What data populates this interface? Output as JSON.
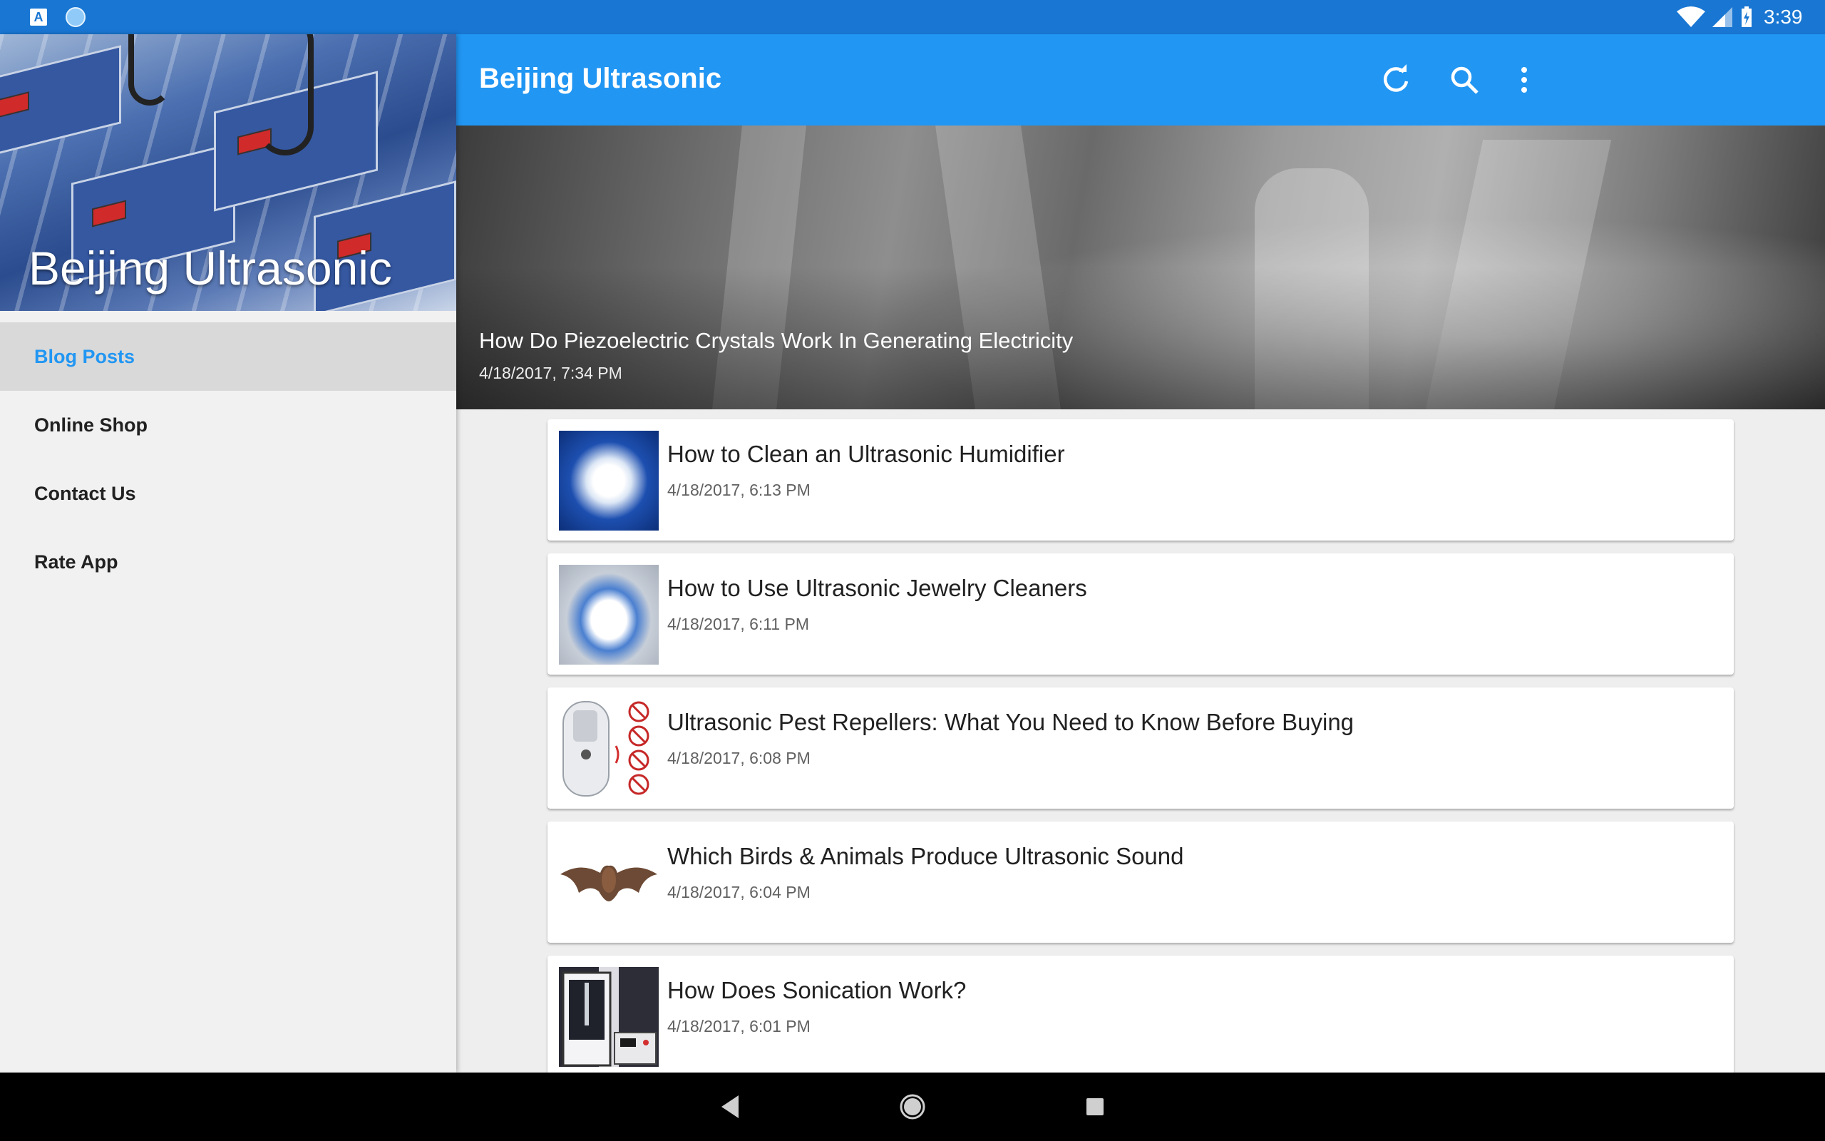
{
  "status_bar": {
    "time": "3:39",
    "notification_icon": "A"
  },
  "drawer": {
    "header_title": "Beijing Ultrasonic",
    "items": [
      {
        "label": "Blog Posts",
        "active": true
      },
      {
        "label": "Online Shop",
        "active": false
      },
      {
        "label": "Contact Us",
        "active": false
      },
      {
        "label": "Rate App",
        "active": false
      }
    ]
  },
  "app_bar": {
    "title": "Beijing Ultrasonic",
    "icons": [
      "refresh-icon",
      "search-icon",
      "more-vert-icon"
    ]
  },
  "featured": {
    "title": "How Do Piezoelectric Crystals Work In Generating Electricity",
    "date": "4/18/2017, 7:34 PM"
  },
  "posts": [
    {
      "title": "How to Clean an Ultrasonic Humidifier",
      "date": "4/18/2017, 6:13 PM",
      "thumb": "humidifier"
    },
    {
      "title": "How to Use Ultrasonic Jewelry Cleaners",
      "date": "4/18/2017, 6:11 PM",
      "thumb": "jewelry-cleaner"
    },
    {
      "title": "Ultrasonic Pest Repellers: What You Need to Know Before Buying",
      "date": "4/18/2017, 6:08 PM",
      "thumb": "pest-repeller"
    },
    {
      "title": "Which Birds & Animals Produce Ultrasonic Sound",
      "date": "4/18/2017, 6:04 PM",
      "thumb": "bat"
    },
    {
      "title": "How Does Sonication Work?",
      "date": "4/18/2017, 6:01 PM",
      "thumb": "sonicator"
    }
  ],
  "colors": {
    "status_bar": "#1976d2",
    "app_bar": "#2196f3",
    "accent": "#2196f3",
    "drawer_bg": "#f1f1f1",
    "active_item_bg": "#d9d9d9"
  }
}
